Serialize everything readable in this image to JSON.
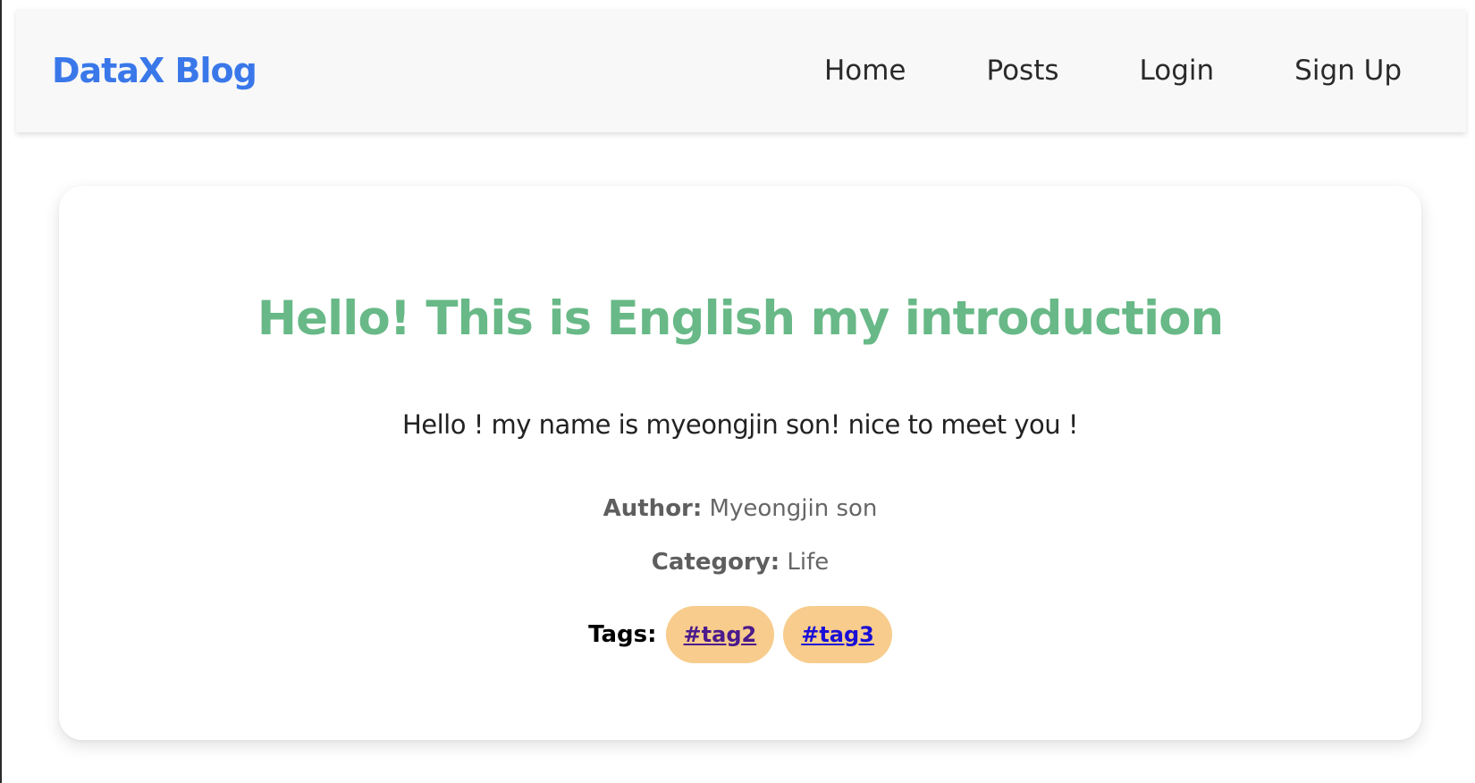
{
  "navbar": {
    "brand": "DataX Blog",
    "links": [
      "Home",
      "Posts",
      "Login",
      "Sign Up"
    ]
  },
  "post": {
    "title": "Hello! This is English my introduction",
    "body": "Hello ! my name is myeongjin son! nice to meet you !",
    "author_label": "Author:",
    "author": "Myeongjin son",
    "category_label": "Category:",
    "category": "Life",
    "tags_label": "Tags:",
    "tags": [
      "#tag2",
      "#tag3"
    ]
  },
  "colors": {
    "brand": "#3a78ea",
    "title": "#68b987",
    "tag_background": "#f7cc8c",
    "tag_visited_link": "#4b1a8c",
    "tag_link": "#1a0fd6"
  }
}
